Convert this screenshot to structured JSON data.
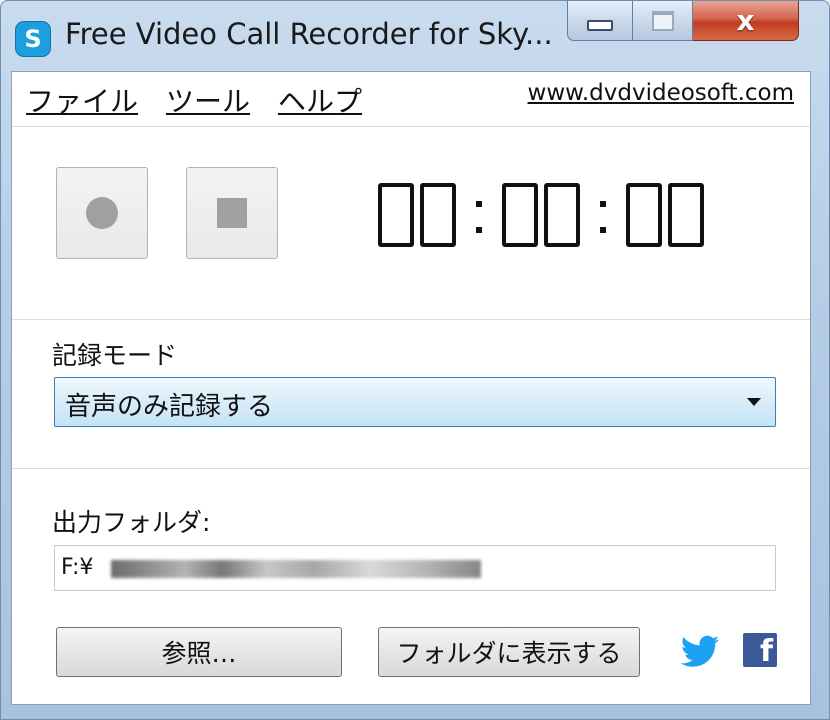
{
  "window": {
    "title": "Free Video Call Recorder for Sky...",
    "app_icon": "skype-icon",
    "close_label": "x"
  },
  "menu": {
    "items": [
      {
        "label": "ファイル",
        "icon": null
      },
      {
        "label": "ツール",
        "icon": null
      },
      {
        "label": "ヘルプ",
        "icon": null
      }
    ],
    "site_link": "www.dvdvideosoft.com"
  },
  "recorder": {
    "record_button": "record-icon",
    "stop_button": "stop-icon",
    "timer": {
      "hours": "00",
      "minutes": "00",
      "seconds": "00"
    }
  },
  "mode": {
    "label": "記録モード",
    "selected": "音声のみ記録する"
  },
  "output": {
    "label": "出力フォルダ:",
    "path_prefix": "F:¥",
    "browse_label": "参照…",
    "show_folder_label": "フォルダに表示する"
  },
  "social": {
    "twitter_icon": "twitter-icon",
    "facebook_icon": "facebook-icon",
    "facebook_glyph": "f",
    "twitter_color": "#1da1f2",
    "facebook_color": "#3b5998"
  }
}
